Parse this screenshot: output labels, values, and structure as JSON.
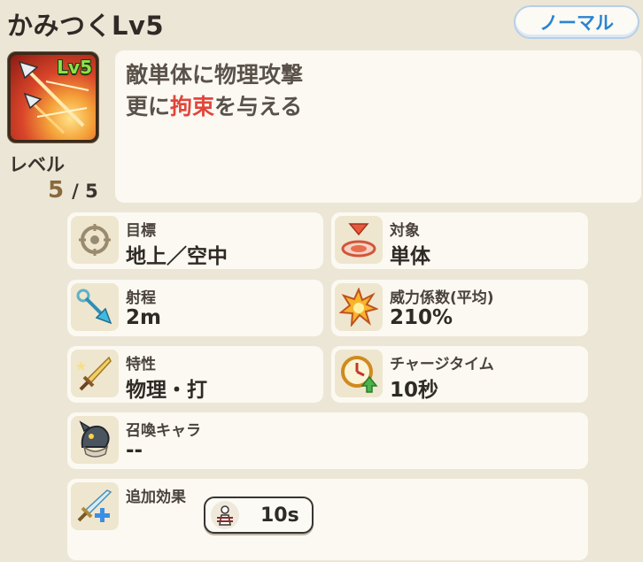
{
  "skill": {
    "title": "かみつくLv5",
    "type_badge": "ノーマル",
    "icon_level": "Lv5",
    "level_label": "レベル",
    "level_current": "5",
    "level_max": "/ 5",
    "description": {
      "line1": "敵単体に物理攻撃",
      "line2_prefix": "更に",
      "line2_highlight": "拘束",
      "line2_suffix": "を与える"
    }
  },
  "stats": [
    {
      "label": "目標",
      "value": "地上／空中",
      "icon": "crosshair-icon"
    },
    {
      "label": "対象",
      "value": "単体",
      "icon": "target-marker-icon"
    },
    {
      "label": "射程",
      "value": "2m",
      "icon": "arrow-range-icon"
    },
    {
      "label": "威力係数(平均)",
      "value": "210%",
      "icon": "explosion-icon"
    },
    {
      "label": "特性",
      "value": "物理・打",
      "icon": "sword-icon"
    },
    {
      "label": "チャージタイム",
      "value": "10秒",
      "icon": "clock-charge-icon"
    },
    {
      "label": "召喚キャラ",
      "value": "--",
      "icon": "summon-creature-icon"
    },
    {
      "label": "追加効果",
      "value": "",
      "icon": "sword-plus-icon"
    }
  ],
  "effect": {
    "duration": "10s",
    "icon": "bind-status-icon"
  },
  "colors": {
    "background": "#ece6d6",
    "panel": "#fbf9f2",
    "accent_blue": "#2c84d0",
    "highlight_red": "#e0463c",
    "level_green": "#8fe04a"
  }
}
